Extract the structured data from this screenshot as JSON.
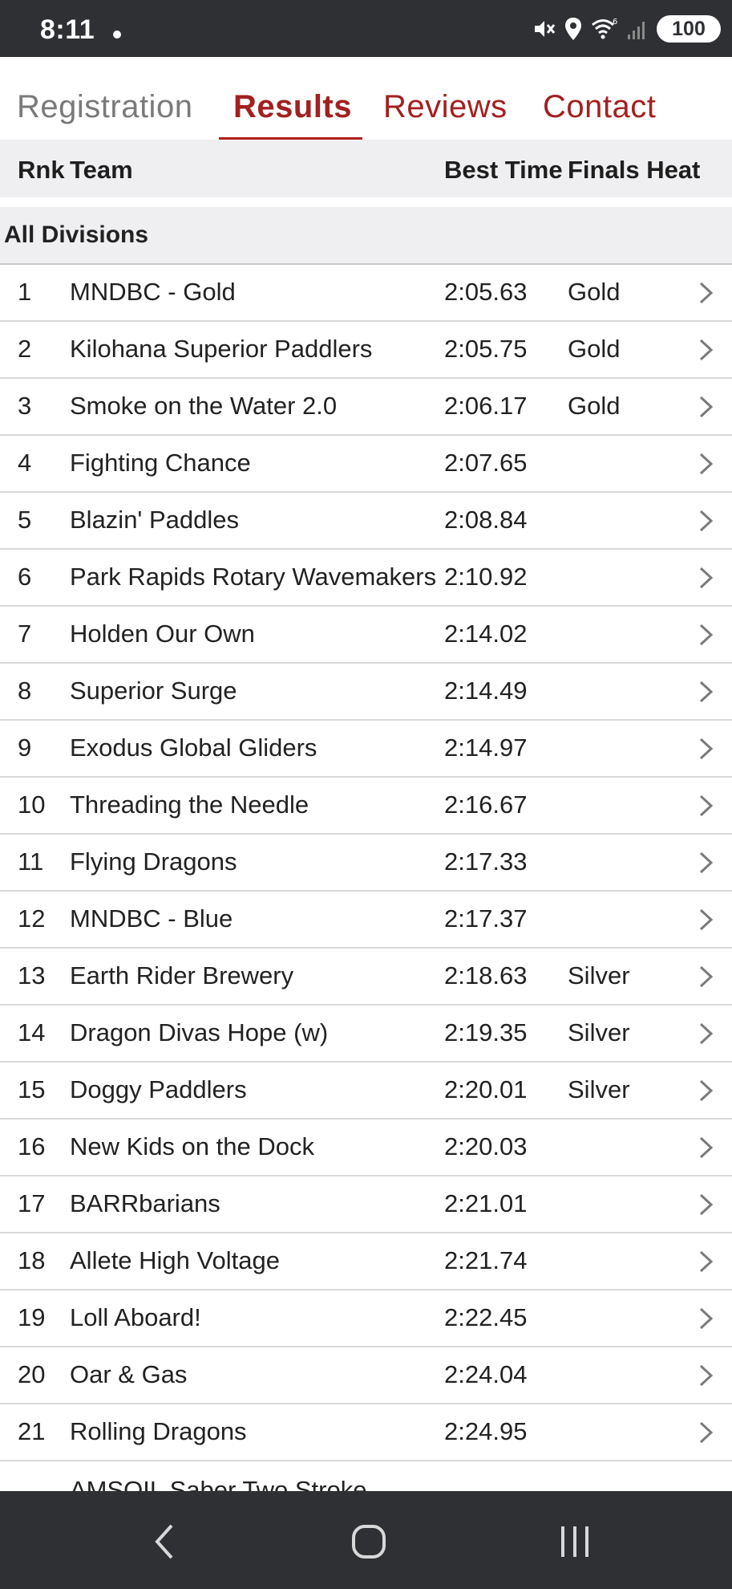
{
  "status_bar": {
    "time": "8:11",
    "battery": "100"
  },
  "tabs": [
    {
      "label": "Registration",
      "active": false
    },
    {
      "label": "Results",
      "active": true
    },
    {
      "label": "Reviews",
      "active": false
    },
    {
      "label": "Contact",
      "active": false
    }
  ],
  "columns": {
    "rank": "Rnk",
    "team": "Team",
    "best_time": "Best Time",
    "finals_heat": "Finals Heat"
  },
  "section_title": "All Divisions",
  "results": [
    {
      "rank": "1",
      "team": "MNDBC - Gold",
      "time": "2:05.63",
      "heat": "Gold"
    },
    {
      "rank": "2",
      "team": "Kilohana Superior Paddlers",
      "time": "2:05.75",
      "heat": "Gold"
    },
    {
      "rank": "3",
      "team": "Smoke on the Water 2.0",
      "time": "2:06.17",
      "heat": "Gold"
    },
    {
      "rank": "4",
      "team": "Fighting Chance",
      "time": "2:07.65",
      "heat": ""
    },
    {
      "rank": "5",
      "team": "Blazin' Paddles",
      "time": "2:08.84",
      "heat": ""
    },
    {
      "rank": "6",
      "team": "Park Rapids Rotary Wavemakers",
      "time": "2:10.92",
      "heat": ""
    },
    {
      "rank": "7",
      "team": "Holden Our Own",
      "time": "2:14.02",
      "heat": ""
    },
    {
      "rank": "8",
      "team": "Superior Surge",
      "time": "2:14.49",
      "heat": ""
    },
    {
      "rank": "9",
      "team": "Exodus Global Gliders",
      "time": "2:14.97",
      "heat": ""
    },
    {
      "rank": "10",
      "team": "Threading the Needle",
      "time": "2:16.67",
      "heat": ""
    },
    {
      "rank": "11",
      "team": "Flying Dragons",
      "time": "2:17.33",
      "heat": ""
    },
    {
      "rank": "12",
      "team": "MNDBC - Blue",
      "time": "2:17.37",
      "heat": ""
    },
    {
      "rank": "13",
      "team": "Earth Rider Brewery",
      "time": "2:18.63",
      "heat": "Silver"
    },
    {
      "rank": "14",
      "team": "Dragon Divas Hope (w)",
      "time": "2:19.35",
      "heat": "Silver"
    },
    {
      "rank": "15",
      "team": "Doggy Paddlers",
      "time": "2:20.01",
      "heat": "Silver"
    },
    {
      "rank": "16",
      "team": "New Kids on the Dock",
      "time": "2:20.03",
      "heat": ""
    },
    {
      "rank": "17",
      "team": "BARRbarians",
      "time": "2:21.01",
      "heat": ""
    },
    {
      "rank": "18",
      "team": "Allete High Voltage",
      "time": "2:21.74",
      "heat": ""
    },
    {
      "rank": "19",
      "team": "Loll Aboard!",
      "time": "2:22.45",
      "heat": ""
    },
    {
      "rank": "20",
      "team": "Oar & Gas",
      "time": "2:24.04",
      "heat": ""
    },
    {
      "rank": "21",
      "team": "Rolling Dragons",
      "time": "2:24.95",
      "heat": ""
    }
  ],
  "partial_row": {
    "team": "AMSOIL Saber Two Stroke"
  },
  "icons": {
    "row_chevron": "chevron-right-icon",
    "status": [
      "mute-vibrate-icon",
      "location-icon",
      "wifi-6-icon",
      "signal-icon"
    ],
    "nav": [
      "back-icon",
      "home-icon",
      "recents-icon"
    ]
  },
  "colors": {
    "accent": "#b01e1e",
    "status_bar": "#2f3034",
    "header_bg": "#efeff1"
  }
}
